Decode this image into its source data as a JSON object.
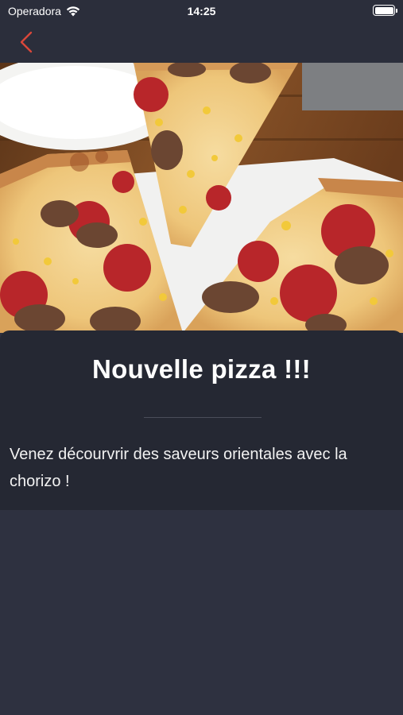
{
  "status_bar": {
    "carrier": "Operadora",
    "time": "14:25"
  },
  "nav": {
    "back_icon": "chevron-left-icon",
    "accent_color": "#d9473a"
  },
  "hero": {
    "image_subject": "pizza-image"
  },
  "article": {
    "title": "Nouvelle pizza !!!",
    "description": "Venez décourvrir des saveurs orientales avec la chorizo !"
  },
  "colors": {
    "topbar": "#2b2e3b",
    "card": "#252833",
    "background": "#2e3140"
  }
}
